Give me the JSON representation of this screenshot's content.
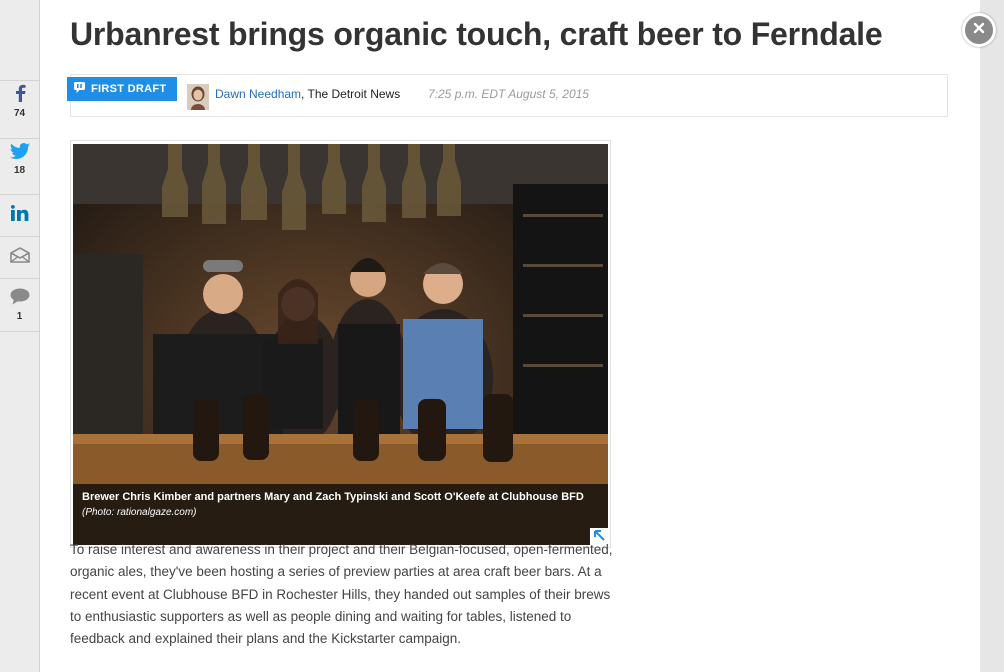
{
  "share_rail": {
    "facebook": {
      "icon": "facebook-icon",
      "count": "74"
    },
    "twitter": {
      "icon": "twitter-icon",
      "count": "18"
    },
    "linkedin": {
      "icon": "linkedin-icon"
    },
    "email": {
      "icon": "email-icon"
    },
    "comments": {
      "icon": "comment-icon",
      "count": "1"
    }
  },
  "article": {
    "headline": "Urbanrest brings organic touch, craft beer to Ferndale",
    "badge_label": "FIRST DRAFT",
    "author_name": "Dawn Needham",
    "publication": ", The Detroit News",
    "timestamp": "7:25 p.m. EDT August 5, 2015",
    "photo_caption": "Brewer Chris Kimber and partners Mary and Zach Typinski and Scott O'Keefe at Clubhouse BFD",
    "photo_credit": "(Photo: rationalgaze.com)",
    "body_text": "To raise interest and awareness in their project and their Belgian-focused, open-fermented, organic ales, they've been hosting a series of preview parties at area craft beer bars. At a recent event at Clubhouse BFD in Rochester Hills, they handed out samples of their brews to enthusiastic supporters as well as people dining and waiting for tables, listened to feedback and explained their plans and the Kickstarter campaign."
  },
  "colors": {
    "accent": "#1e8ee6",
    "facebook": "#3b5998",
    "twitter": "#1da1f2",
    "linkedin": "#0077b5",
    "link": "#1e6fb8"
  }
}
